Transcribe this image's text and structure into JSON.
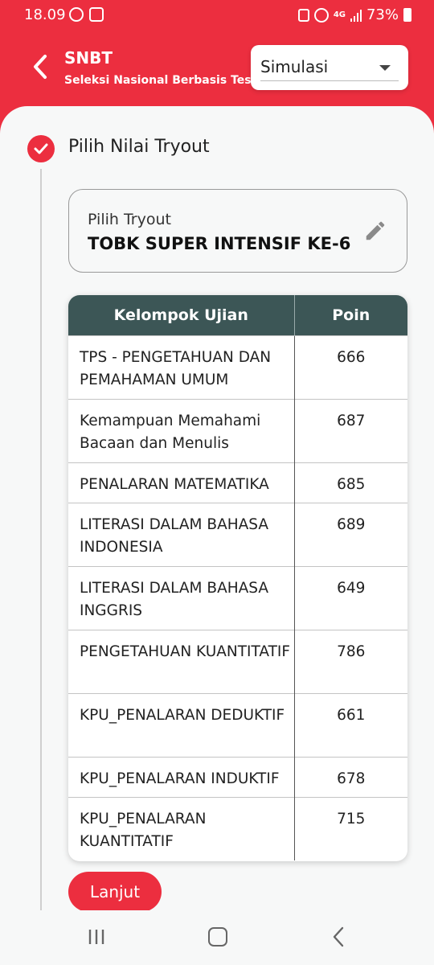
{
  "status_bar": {
    "time": "18.09",
    "network": "4G",
    "battery": "73%"
  },
  "header": {
    "title": "SNBT",
    "subtitle": "Seleksi Nasional Berbasis Tes",
    "mode_select": {
      "selected": "Simulasi"
    },
    "colors": {
      "accent": "#ec2e3f",
      "table_header": "#3c5656"
    }
  },
  "step": {
    "title": "Pilih Nilai Tryout"
  },
  "tryout": {
    "label": "Pilih Tryout",
    "value": "TOBK SUPER INTENSIF KE-6"
  },
  "table": {
    "headers": [
      "Kelompok Ujian",
      "Poin"
    ],
    "rows": [
      {
        "name": "TPS - PENGETAHUAN DAN PEMAHAMAN UMUM",
        "points": "666"
      },
      {
        "name": "Kemampuan Memahami Bacaan dan Menulis",
        "points": "687"
      },
      {
        "name": "PENALARAN MATEMATIKA",
        "points": "685"
      },
      {
        "name": "LITERASI DALAM BAHASA INDONESIA",
        "points": "689"
      },
      {
        "name": "LITERASI DALAM BAHASA INGGRIS",
        "points": "649"
      },
      {
        "name": "PENGETAHUAN KUANTITATIF",
        "points": "786"
      },
      {
        "name": "KPU_PENALARAN DEDUKTIF",
        "points": "661"
      },
      {
        "name": "KPU_PENALARAN INDUKTIF",
        "points": "678"
      },
      {
        "name": "KPU_PENALARAN KUANTITATIF",
        "points": "715"
      }
    ]
  },
  "actions": {
    "next_label": "Lanjut"
  }
}
